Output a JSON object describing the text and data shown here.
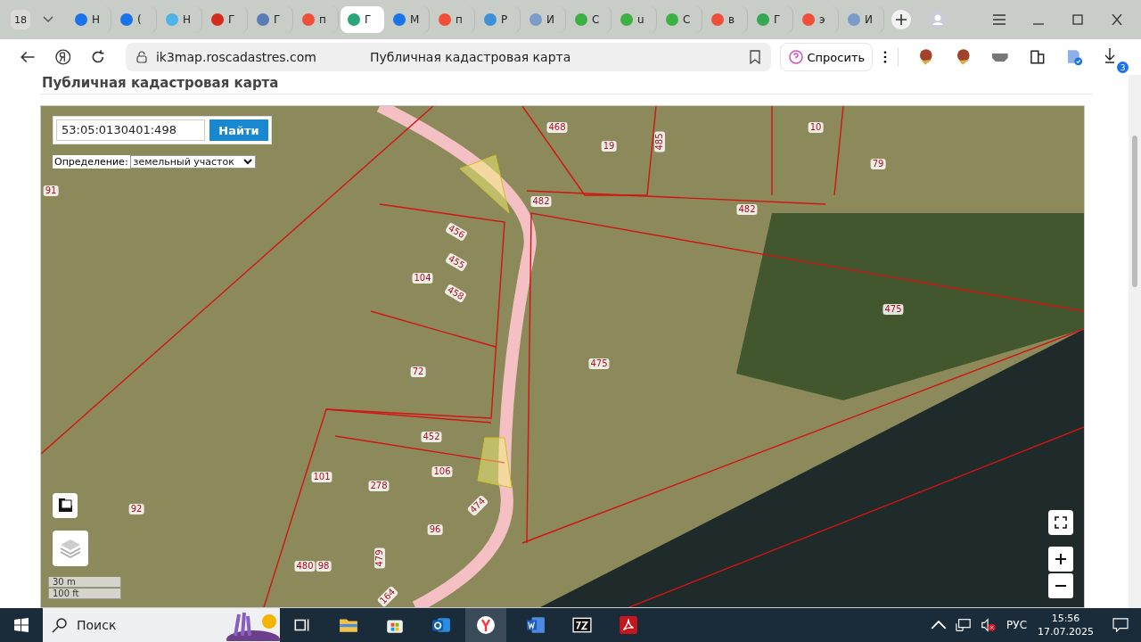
{
  "browser": {
    "tab_count": "18",
    "tabs": [
      {
        "label": "Н",
        "color": "#1a73e8",
        "selected": false
      },
      {
        "label": "(",
        "color": "#1a73e8",
        "selected": false
      },
      {
        "label": "Н",
        "color": "#4fb3e8",
        "selected": false
      },
      {
        "label": "Г",
        "color": "#d52b1e",
        "selected": false
      },
      {
        "label": "Г",
        "color": "#5b7bb5",
        "selected": false
      },
      {
        "label": "п",
        "color": "#f0503a",
        "selected": false
      },
      {
        "label": "Г",
        "color": "#2ba57a",
        "selected": true
      },
      {
        "label": "М",
        "color": "#1a73e8",
        "selected": false
      },
      {
        "label": "п",
        "color": "#f0503a",
        "selected": false
      },
      {
        "label": "Р",
        "color": "#3d8fd6",
        "selected": false
      },
      {
        "label": "И",
        "color": "#7b9cc8",
        "selected": false
      },
      {
        "label": "С",
        "color": "#3cb043",
        "selected": false
      },
      {
        "label": "u",
        "color": "#3cb043",
        "selected": false
      },
      {
        "label": "С",
        "color": "#3cb043",
        "selected": false
      },
      {
        "label": "в",
        "color": "#f0503a",
        "selected": false
      },
      {
        "label": "Г",
        "color": "#34a853",
        "selected": false
      },
      {
        "label": "э",
        "color": "#f0503a",
        "selected": false
      },
      {
        "label": "И",
        "color": "#7b9cc8",
        "selected": false
      }
    ],
    "url": "ik3map.roscadastres.com",
    "page_title": "Публичная кадастровая карта",
    "ask_button": "Спросить",
    "downloads_badge": "3"
  },
  "page": {
    "heading": "Публичная кадастровая карта",
    "map": {
      "search_value": "53:05:0130401:498",
      "search_button": "Найти",
      "mode_label": "Определение:",
      "mode_value": "земельный участок",
      "parcel_labels": [
        "468",
        "19",
        "485",
        "10",
        "79",
        "91",
        "482",
        "482",
        "456",
        "455",
        "104",
        "458",
        "475",
        "475",
        "72",
        "452",
        "106",
        "101",
        "278",
        "474",
        "92",
        "96",
        "479",
        "480",
        "98",
        "164"
      ],
      "scale": [
        "30 m",
        "100 ft"
      ]
    }
  },
  "taskbar": {
    "search_placeholder": "Поиск",
    "language": "РУС",
    "time": "15:56",
    "date": "17.07.2025"
  }
}
